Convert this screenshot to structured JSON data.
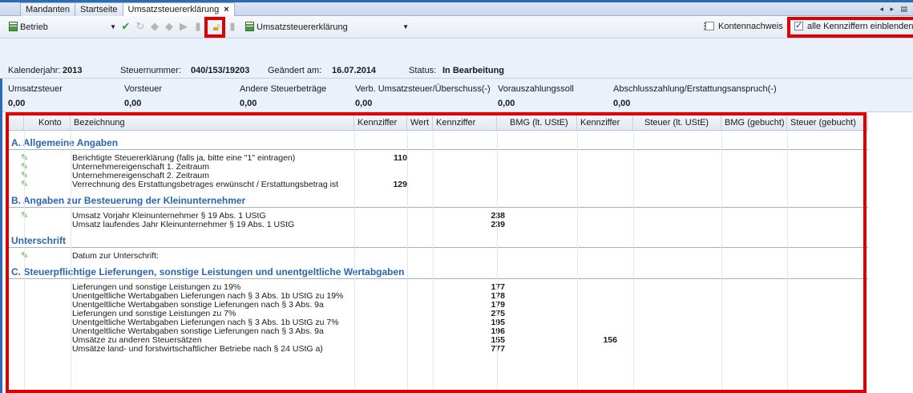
{
  "tabs": [
    {
      "label": "Mandanten",
      "active": false
    },
    {
      "label": "Startseite",
      "active": false
    },
    {
      "label": "Umsatzsteuererklärung",
      "active": true
    }
  ],
  "tab_close_icon": "×",
  "tab_nav": "◂ ▸ ▤",
  "toolbar": {
    "context_combo": "Betrieb",
    "form_combo": "Umsatzsteuererklärung",
    "kontennachweis_label": "Kontennachweis",
    "kontennachweis_checked": false,
    "alle_kennziffern_label": "alle Kennziffern einblenden",
    "alle_kennziffern_checked": true
  },
  "info": {
    "kalenderjahr_label": "Kalenderjahr:",
    "kalenderjahr": "2013",
    "steuernummer_label": "Steuernummer:",
    "steuernummer": "040/153/19203",
    "geaendert_label": "Geändert am:",
    "geaendert": "16.07.2014",
    "status_label": "Status:",
    "status": "In Bearbeitung"
  },
  "summary": [
    {
      "label": "Umsatzsteuer",
      "value": "0,00"
    },
    {
      "label": "Vorsteuer",
      "value": "0,00"
    },
    {
      "label": "Andere Steuerbeträge",
      "value": "0,00"
    },
    {
      "label": "Verb. Umsatzsteuer/Überschuss(-)",
      "value": "0,00"
    },
    {
      "label": "Vorauszahlungssoll",
      "value": "0,00"
    },
    {
      "label": "Abschlusszahlung/Erstattungsanspruch(-)",
      "value": "0,00"
    }
  ],
  "grid": {
    "columns": [
      "Konto",
      "Bezeichnung",
      "Kennziffer",
      "Wert",
      "Kennziffer",
      "BMG (lt. UStE)",
      "Kennziffer",
      "Steuer (lt. UStE)",
      "BMG (gebucht)",
      "Steuer (gebucht)"
    ],
    "sections": [
      {
        "title": "A. Allgemeine Angaben",
        "rows": [
          {
            "desc": "Berichtigte Steuererklärung (falls ja, bitte eine \"1\" eintragen)",
            "k1": "110",
            "k2": "",
            "k3": "",
            "pencil": true
          },
          {
            "desc": "Unternehmereigenschaft 1. Zeitraum",
            "k1": "",
            "k2": "",
            "k3": "",
            "pencil": true
          },
          {
            "desc": "Unternehmereigenschaft 2. Zeitraum",
            "k1": "",
            "k2": "",
            "k3": "",
            "pencil": true
          },
          {
            "desc": "Verrechnung des Erstattungsbetrages erwünscht / Erstattungsbetrag ist",
            "k1": "129",
            "k2": "",
            "k3": "",
            "pencil": true
          }
        ]
      },
      {
        "title": "B. Angaben zur Besteuerung der Kleinunternehmer",
        "rows": [
          {
            "desc": "Umsatz Vorjahr Kleinunternehmer § 19 Abs. 1 UStG",
            "k1": "",
            "k2": "238",
            "k3": "",
            "pencil": true
          },
          {
            "desc": "Umsatz laufendes Jahr Kleinunternehmer § 19 Abs. 1 UStG",
            "k1": "",
            "k2": "239",
            "k3": "",
            "pencil": false
          }
        ]
      },
      {
        "title": "Unterschrift",
        "rows": [
          {
            "desc": "Datum zur Unterschrift:",
            "k1": "",
            "k2": "",
            "k3": "",
            "pencil": true
          }
        ]
      },
      {
        "title": "C. Steuerpflichtige Lieferungen, sonstige Leistungen und unentgeltliche Wertabgaben",
        "rows": [
          {
            "desc": "Lieferungen und sonstige Leistungen zu 19%",
            "k1": "",
            "k2": "177",
            "k3": "",
            "pencil": false
          },
          {
            "desc": "Unentgeltliche Wertabgaben Lieferungen nach § 3 Abs. 1b UStG zu 19%",
            "k1": "",
            "k2": "178",
            "k3": "",
            "pencil": false
          },
          {
            "desc": "Unentgeltliche Wertabgaben sonstige Lieferungen nach § 3 Abs. 9a",
            "k1": "",
            "k2": "179",
            "k3": "",
            "pencil": false
          },
          {
            "desc": "Lieferungen und sonstige Leistungen zu 7%",
            "k1": "",
            "k2": "275",
            "k3": "",
            "pencil": false
          },
          {
            "desc": "Unentgeltliche Wertabgaben Lieferungen nach § 3 Abs. 1b UStG zu 7%",
            "k1": "",
            "k2": "195",
            "k3": "",
            "pencil": false
          },
          {
            "desc": "Unentgeltliche Wertabgaben sonstige Lieferungen nach § 3 Abs. 9a",
            "k1": "",
            "k2": "196",
            "k3": "",
            "pencil": false
          },
          {
            "desc": "Umsätze zu anderen Steuersätzen",
            "k1": "",
            "k2": "155",
            "k3": "156",
            "pencil": false
          },
          {
            "desc": "Umsätze land- und forstwirtschaftlicher Betriebe nach § 24 UStG a)",
            "k1": "",
            "k2": "777",
            "k3": "",
            "pencil": false
          }
        ]
      }
    ]
  },
  "colors": {
    "accent": "#2b6bb8",
    "section_text": "#2a66b0",
    "highlight": "#e00000",
    "check_green": "#2f9a2f"
  }
}
